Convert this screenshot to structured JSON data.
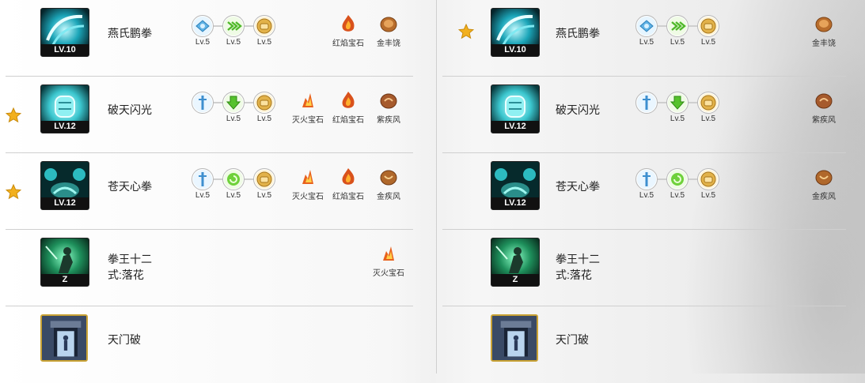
{
  "left": {
    "rows": [
      {
        "star": false,
        "name": "燕氏鹏拳",
        "level": "LV.10",
        "icon": "wave-skill-icon",
        "runes": [
          {
            "icon": "blue-crystal-rune-icon",
            "lv": "Lv.5"
          },
          {
            "icon": "green-arrows-rune-icon",
            "lv": "Lv.5"
          },
          {
            "icon": "gold-fist-rune-icon",
            "lv": "Lv.5"
          }
        ],
        "gems": [
          {
            "icon": "red-flame-gem-icon",
            "label": "红焰宝石"
          },
          {
            "icon": "gold-fengrao-gem-icon",
            "label": "金丰饶"
          }
        ]
      },
      {
        "star": true,
        "name": "破天闪光",
        "level": "LV.12",
        "icon": "fist-skill-icon",
        "runes": [
          {
            "icon": "blue-sword-rune-icon",
            "lv": ""
          },
          {
            "icon": "green-down-rune-icon",
            "lv": "Lv.5"
          },
          {
            "icon": "gold-fist-rune-icon",
            "lv": "Lv.5"
          }
        ],
        "gems": [
          {
            "icon": "fire-gem-icon",
            "label": "灭火宝石"
          },
          {
            "icon": "red-flame-gem-icon",
            "label": "红焰宝石"
          },
          {
            "icon": "purple-wind-gem-icon",
            "label": "紫疾风"
          }
        ]
      },
      {
        "star": true,
        "name": "苍天心拳",
        "level": "LV.12",
        "icon": "palm-skill-icon",
        "runes": [
          {
            "icon": "blue-sword-rune-icon",
            "lv": "Lv.5"
          },
          {
            "icon": "green-spiral-rune-icon",
            "lv": "Lv.5"
          },
          {
            "icon": "gold-fist-rune-icon",
            "lv": "Lv.5"
          }
        ],
        "gems": [
          {
            "icon": "fire-gem-icon",
            "label": "灭火宝石"
          },
          {
            "icon": "red-flame-gem-icon",
            "label": "红焰宝石"
          },
          {
            "icon": "gold-wind-gem-icon",
            "label": "金疾风"
          }
        ]
      },
      {
        "star": false,
        "name": "拳王十二式:落花",
        "level": "Z",
        "icon": "fighter-skill-icon",
        "runes": [],
        "gems": [
          {
            "icon": "fire-gem-icon",
            "label": "灭火宝石"
          }
        ]
      },
      {
        "star": false,
        "name": "天门破",
        "level": "",
        "icon": "gate-skill-icon",
        "runes": [],
        "gems": []
      }
    ]
  },
  "right": {
    "rows": [
      {
        "star": true,
        "name": "燕氏鹏拳",
        "level": "LV.10",
        "icon": "wave-skill-icon",
        "runes": [
          {
            "icon": "blue-crystal-rune-icon",
            "lv": "Lv.5"
          },
          {
            "icon": "green-arrows-rune-icon",
            "lv": "Lv.5"
          },
          {
            "icon": "gold-fist-rune-icon",
            "lv": "Lv.5"
          }
        ],
        "gems": [
          {
            "icon": "gold-fengrao-gem-icon",
            "label": "金丰饶"
          }
        ]
      },
      {
        "star": false,
        "name": "破天闪光",
        "level": "LV.12",
        "icon": "fist-skill-icon",
        "runes": [
          {
            "icon": "blue-sword-rune-icon",
            "lv": ""
          },
          {
            "icon": "green-down-rune-icon",
            "lv": "Lv.5"
          },
          {
            "icon": "gold-fist-rune-icon",
            "lv": "Lv.5"
          }
        ],
        "gems": [
          {
            "icon": "purple-wind-gem-icon",
            "label": "紫疾风"
          }
        ]
      },
      {
        "star": false,
        "name": "苍天心拳",
        "level": "LV.12",
        "icon": "palm-skill-icon",
        "runes": [
          {
            "icon": "blue-sword-rune-icon",
            "lv": "Lv.5"
          },
          {
            "icon": "green-spiral-rune-icon",
            "lv": "Lv.5"
          },
          {
            "icon": "gold-fist-rune-icon",
            "lv": "Lv.5"
          }
        ],
        "gems": [
          {
            "icon": "gold-wind-gem-icon",
            "label": "金疾风"
          }
        ]
      },
      {
        "star": false,
        "name": "拳王十二式:落花",
        "level": "Z",
        "icon": "fighter-skill-icon",
        "runes": [],
        "gems": []
      },
      {
        "star": false,
        "name": "天门破",
        "level": "",
        "icon": "gate-skill-icon",
        "runes": [],
        "gems": []
      }
    ]
  },
  "colors": {
    "star": "#f2b01e",
    "separator": "#cfcfcf",
    "label_bar": "#111111",
    "gold_frame": "#c9a234"
  }
}
